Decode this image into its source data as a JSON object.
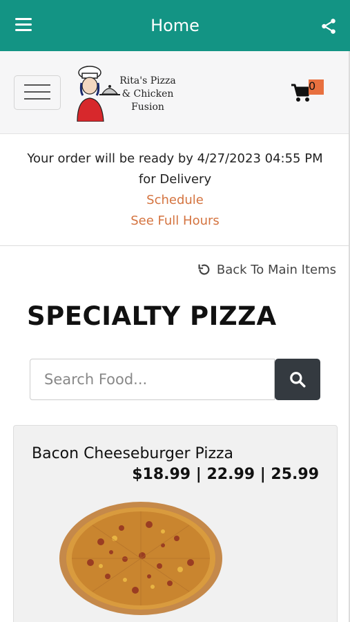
{
  "appbar": {
    "title": "Home",
    "menu_icon": "hamburger-menu-icon",
    "share_icon": "share-icon",
    "color": "#139484"
  },
  "brand": {
    "logo_line1": "Rita's Pizza",
    "logo_line2": "& Chicken",
    "logo_line3": "Fusion",
    "menu_toggle_icon": "hamburger-menu-icon",
    "cart_icon": "shopping-cart-icon",
    "cart_count": "0"
  },
  "order": {
    "ready_text": "Your order will be ready by 4/27/2023 04:55 PM",
    "mode_text": "for Delivery",
    "schedule_label": "Schedule",
    "hours_label": "See Full Hours",
    "link_color": "#d4733f"
  },
  "nav": {
    "back_label": "Back To Main Items",
    "back_icon": "undo-arrow-icon"
  },
  "section": {
    "title": "SPECIALTY PIZZA"
  },
  "search": {
    "placeholder": "Search Food...",
    "value": "",
    "button_icon": "search-icon"
  },
  "items": [
    {
      "name": "Bacon Cheeseburger Pizza",
      "price": "$18.99 | 22.99 | 25.99",
      "image": "pizza-image"
    }
  ]
}
